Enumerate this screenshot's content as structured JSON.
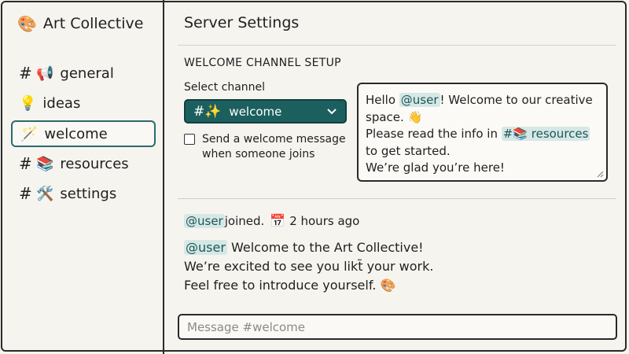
{
  "server": {
    "icon": "palette-icon",
    "emoji": "🎨",
    "name": "Art Collective"
  },
  "sidebar": {
    "items": [
      {
        "hash": "#",
        "emoji": "📢",
        "label": "general",
        "icon": "megaphone-icon",
        "active": false
      },
      {
        "hash": "",
        "emoji": "💡",
        "label": "ideas",
        "icon": "lightbulb-icon",
        "active": false
      },
      {
        "hash": "",
        "emoji": "🪄",
        "label": "welcome",
        "icon": "magic-wand-icon",
        "active": true
      },
      {
        "hash": "#",
        "emoji": "📚",
        "label": "resources",
        "icon": "books-icon",
        "active": false
      },
      {
        "hash": "#",
        "emoji": "🛠️",
        "label": "settings",
        "icon": "tools-icon",
        "active": false
      }
    ]
  },
  "main": {
    "title": "Server Settings",
    "section_title": "WELCOME CHANNEL SETUP",
    "select_label": "Select channel",
    "select_value": "welcome",
    "select_prefix": "#✨",
    "checkbox_label": "Send a welcome message when someone joins",
    "checkbox_checked": false,
    "welcome_message": {
      "hello": "Hello ",
      "mention": "@user",
      "after_mention": "! Welcome to our creative space. 👋",
      "line2_before": "Please read the info in ",
      "channel_mention": "#📚 resources",
      "line2_after": "to get started.",
      "line3": "We’re glad you’re here!"
    },
    "joined": {
      "mention": "@user",
      "text": " joined.",
      "calendar_emoji": "📅",
      "time": "2 hours ago"
    },
    "message": {
      "mention": "@user",
      "line1": " Welcome to the Art Collective!",
      "line2": "We’re excited to see you likt̃ your work.",
      "line3": "Feel free to introduce yourself. 🎨"
    },
    "composer_placeholder": "Message #welcome"
  },
  "colors": {
    "accent": "#1c5f5f",
    "mention_bg": "#d6e8e6",
    "background": "#f6f4ef"
  }
}
